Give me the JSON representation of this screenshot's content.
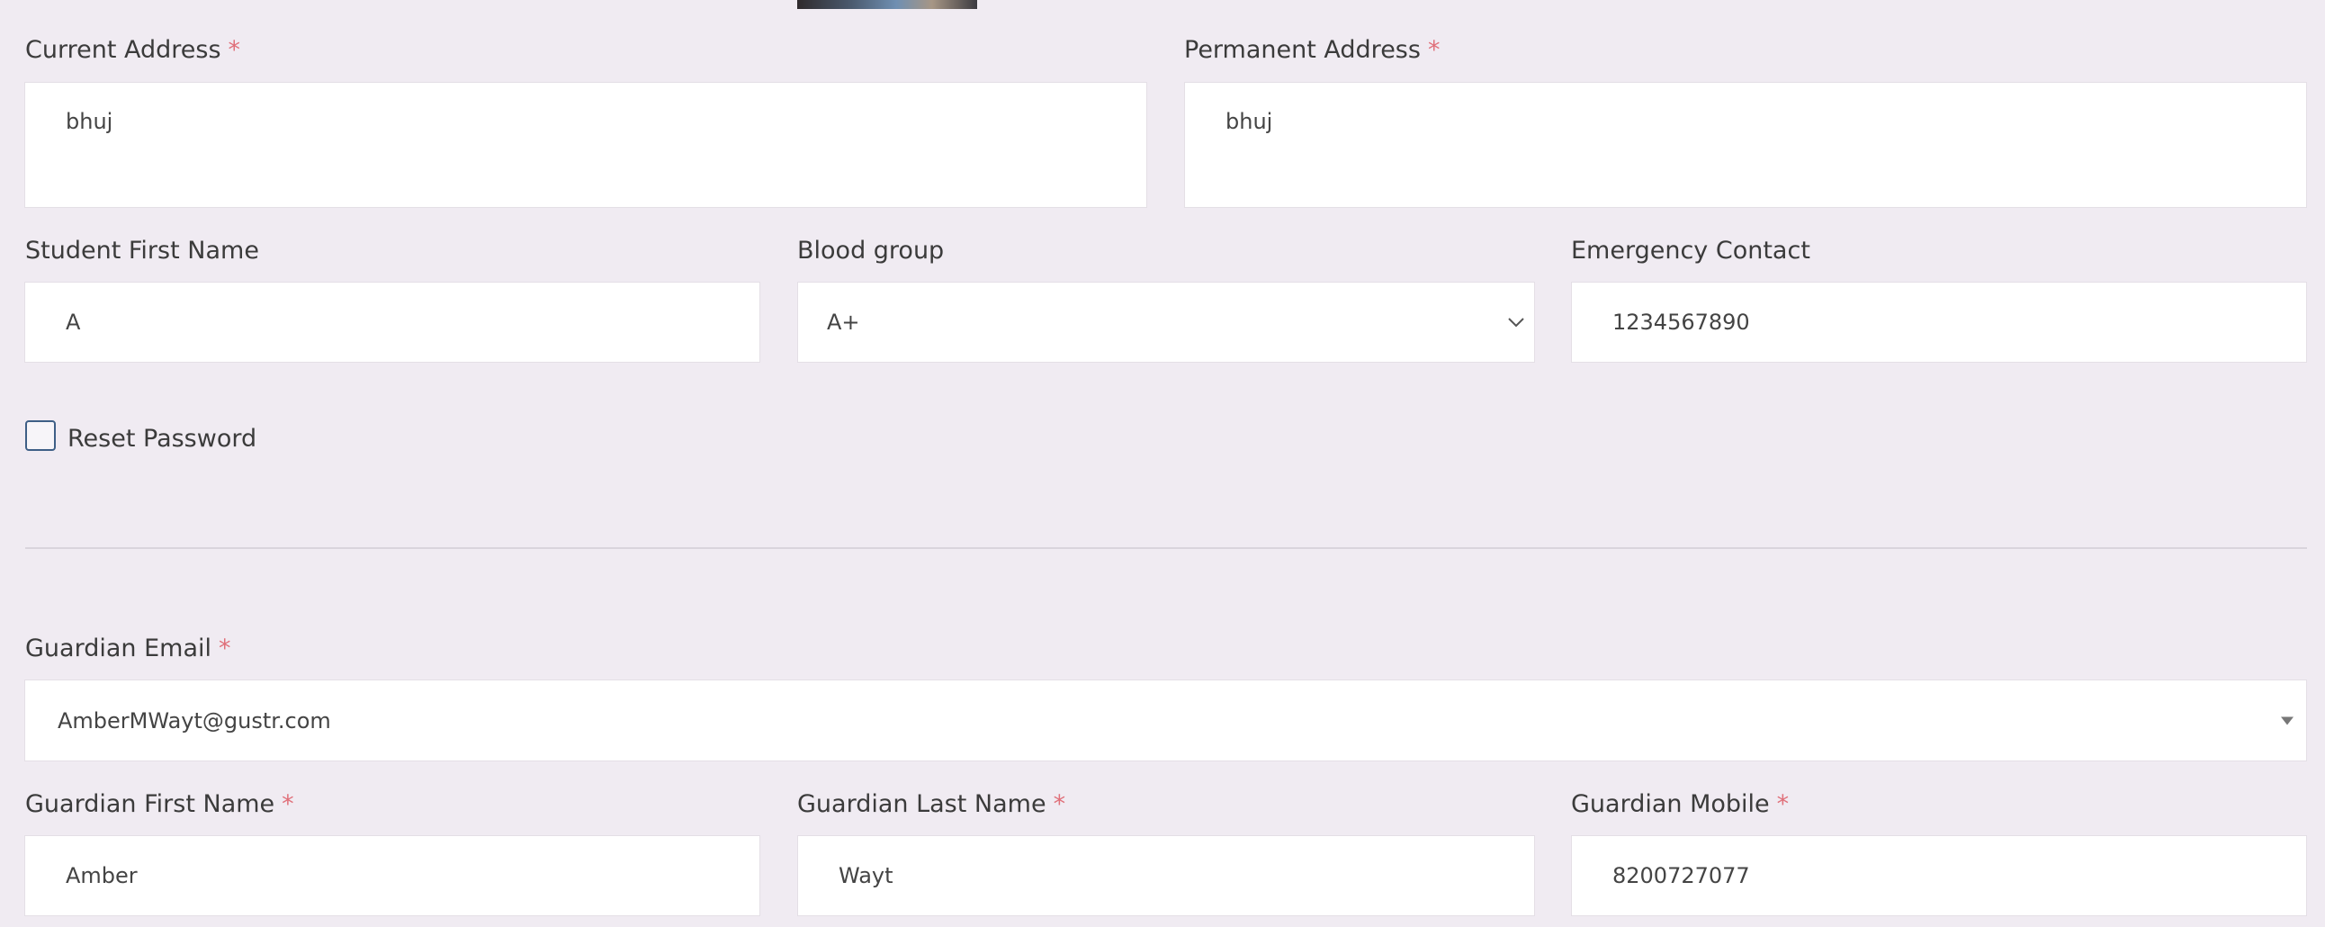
{
  "form": {
    "required_marker": "*",
    "current_address": {
      "label": "Current Address",
      "value": "bhuj"
    },
    "permanent_address": {
      "label": "Permanent Address",
      "value": "bhuj"
    },
    "student_first_name": {
      "label": "Student First Name",
      "value": "A"
    },
    "blood_group": {
      "label": "Blood group",
      "value": "A+"
    },
    "emergency_contact": {
      "label": "Emergency Contact",
      "value": "1234567890"
    },
    "reset_password": {
      "label": "Reset Password",
      "checked": false
    },
    "guardian_email": {
      "label": "Guardian Email",
      "value": "AmberMWayt@gustr.com"
    },
    "guardian_first_name": {
      "label": "Guardian First Name",
      "value": "Amber"
    },
    "guardian_last_name": {
      "label": "Guardian Last Name",
      "value": "Wayt"
    },
    "guardian_mobile": {
      "label": "Guardian Mobile",
      "value": "8200727077"
    }
  },
  "colors": {
    "background": "#f0ebf2",
    "required": "#e0707a",
    "checkbox_border": "#3e5f86"
  },
  "icons": {
    "blood_group_dropdown": "chevron-down-icon",
    "guardian_email_dropdown": "caret-down-icon"
  }
}
